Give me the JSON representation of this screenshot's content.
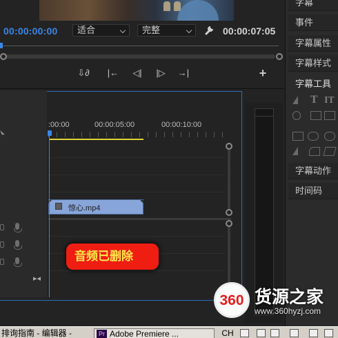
{
  "monitor": {
    "timecode_current": "00:00:00:00",
    "fit_value": "适合",
    "quality_value": "完整",
    "timecode_duration": "00:00:07:05",
    "add_symbol": "+",
    "transport": [
      "⇩∂",
      "|←",
      "◁|",
      "|▷",
      "→|"
    ]
  },
  "right_panel": {
    "items": [
      "字幕",
      "事件",
      "字幕属性",
      "字幕样式",
      "字幕工具",
      "字幕动作",
      "时间码"
    ],
    "tools_text": [
      "T",
      "IT"
    ]
  },
  "timeline": {
    "ruler_labels": [
      ":00:00",
      "00:00:05:00",
      "00:00:10:00"
    ],
    "clip_name": "惊心.mp4",
    "snap_symbol": "▸◂"
  },
  "callout": {
    "text": "音频已删除"
  },
  "watermark": {
    "logo_text": "360",
    "title": "货源之家",
    "url": "www.360hyzj.com"
  },
  "taskbar": {
    "guide_label": "排询指南 - 编辑器 -",
    "premiere_label": "Adobe Premiere ...",
    "premiere_icon": "Pr",
    "lang_label": "CH"
  },
  "colors": {
    "accent_blue": "#3a86e6",
    "work_area": "#e2d23a",
    "clip": "#87a5d8",
    "callout_bg": "#f01d13",
    "callout_text": "#ffe94a"
  }
}
